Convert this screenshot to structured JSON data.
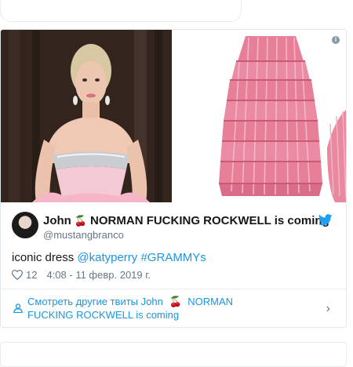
{
  "tweet": {
    "user": {
      "name_part1": "John",
      "emoji": "🍒",
      "name_part2": "NORMAN FUCKING ROCKWELL is coming",
      "handle": "@mustangbranco"
    },
    "text": {
      "plain": "iconic dress ",
      "mention": "@katyperry",
      "hashtag": "#GRAMMYs"
    },
    "likes": "12",
    "timestamp": "4:08 - 11 февр. 2019 г.",
    "more": {
      "prefix": "Смотреть другие твиты John",
      "emoji": "🍒",
      "suffix": "NORMAN FUCKING ROCKWELL is coming"
    }
  },
  "icons": {
    "info": "info-icon",
    "bird": "twitter-bird-icon",
    "heart": "heart-icon",
    "user": "user-icon",
    "chevron": "chevron-right-icon"
  },
  "colors": {
    "link": "#1b95e0",
    "text": "#14171a",
    "secondary": "#657786",
    "twitter_blue": "#1da1f2"
  }
}
